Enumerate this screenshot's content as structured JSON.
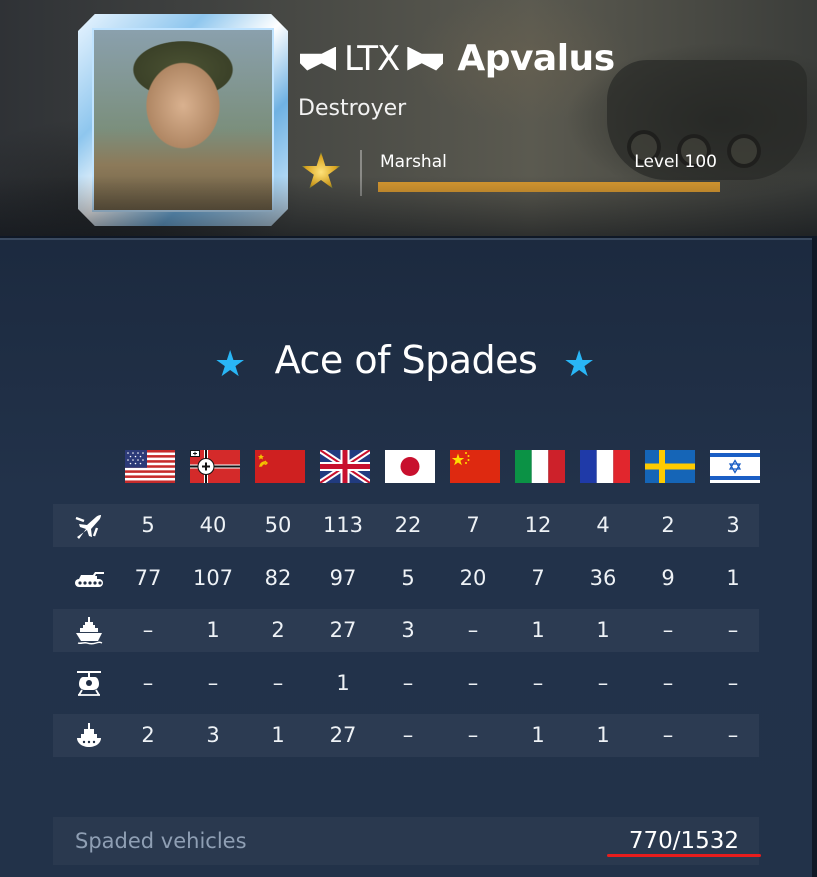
{
  "profile": {
    "squadron_tag": "LTX",
    "player_name": "Apvalus",
    "title": "Destroyer",
    "rank": "Marshal",
    "level_label": "Level 100",
    "level_progress": 1.0
  },
  "achievement": {
    "title": "Ace of Spades"
  },
  "nations": [
    {
      "id": "usa",
      "icon": "usa-flag"
    },
    {
      "id": "germany",
      "icon": "germany-flag"
    },
    {
      "id": "ussr",
      "icon": "ussr-flag"
    },
    {
      "id": "britain",
      "icon": "britain-flag"
    },
    {
      "id": "japan",
      "icon": "japan-flag"
    },
    {
      "id": "china",
      "icon": "china-flag"
    },
    {
      "id": "italy",
      "icon": "italy-flag"
    },
    {
      "id": "france",
      "icon": "france-flag"
    },
    {
      "id": "sweden",
      "icon": "sweden-flag"
    },
    {
      "id": "israel",
      "icon": "israel-flag"
    }
  ],
  "rows": [
    {
      "type": "aviation",
      "icon": "aircraft-icon",
      "values": [
        "5",
        "40",
        "50",
        "113",
        "22",
        "7",
        "12",
        "4",
        "2",
        "3"
      ]
    },
    {
      "type": "ground",
      "icon": "tank-icon",
      "values": [
        "77",
        "107",
        "82",
        "97",
        "5",
        "20",
        "7",
        "36",
        "9",
        "1"
      ]
    },
    {
      "type": "bluewater",
      "icon": "battleship-icon",
      "values": [
        "–",
        "1",
        "2",
        "27",
        "3",
        "–",
        "1",
        "1",
        "–",
        "–"
      ]
    },
    {
      "type": "helicopters",
      "icon": "helicopter-icon",
      "values": [
        "–",
        "–",
        "–",
        "1",
        "–",
        "–",
        "–",
        "–",
        "–",
        "–"
      ]
    },
    {
      "type": "coastal",
      "icon": "boat-icon",
      "values": [
        "2",
        "3",
        "1",
        "27",
        "–",
        "–",
        "1",
        "1",
        "–",
        "–"
      ]
    }
  ],
  "summary": {
    "label": "Spaded vehicles",
    "value": "770/1532"
  },
  "colors": {
    "accent_star": "#29b6f6",
    "progress": "#d99a30",
    "highlight_underline": "#e81d1d"
  }
}
